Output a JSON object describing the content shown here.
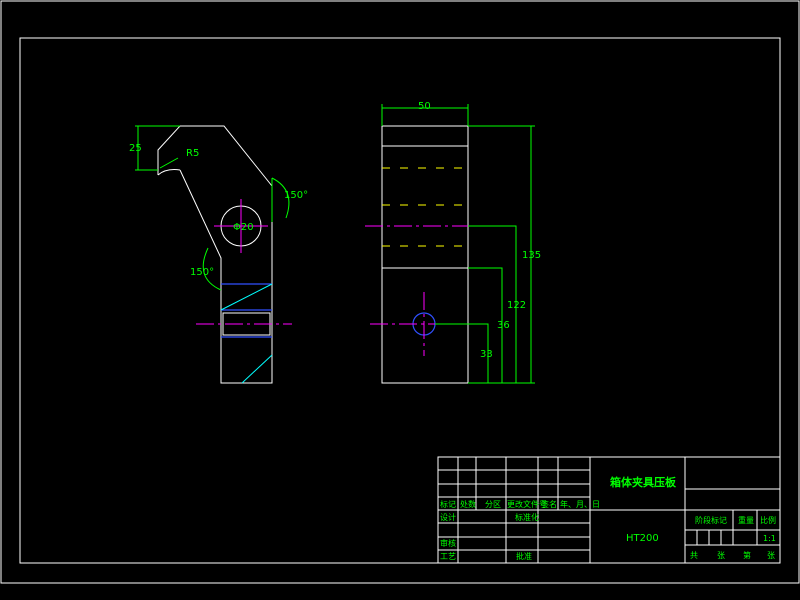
{
  "drawing": {
    "part_name": "箱体夹具压板",
    "material": "HT200",
    "scale": "1:1"
  },
  "dimensions": {
    "d1": "25",
    "d2": "R5",
    "d3": "Φ20",
    "d4": "150°",
    "d5": "150°",
    "d6": "50",
    "d7": "135",
    "d8": "122",
    "d9": "36",
    "d10": "33"
  },
  "title_block": {
    "mark": "标记",
    "count": "处数",
    "zone": "分区",
    "change_doc": "更改文件号",
    "signature": "签名",
    "date": "年、月、日",
    "design": "设计",
    "standardization": "标准化",
    "review": "审核",
    "process": "工艺",
    "approve": "批准",
    "stage_mark": "阶段标记",
    "weight": "重量",
    "scale_label": "比例",
    "total": "共",
    "sheets": "张",
    "sheet_no": "第",
    "sheet": "张"
  }
}
